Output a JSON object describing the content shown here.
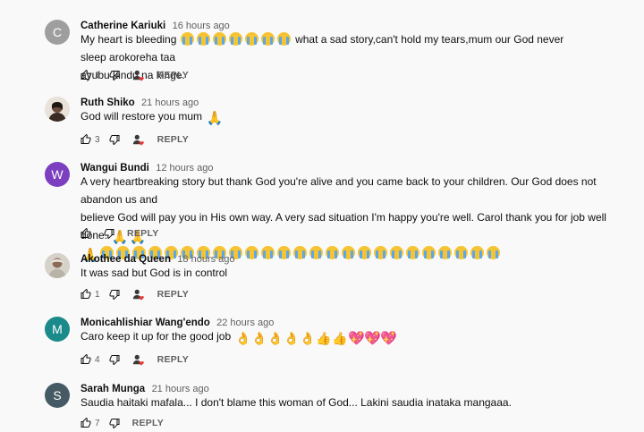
{
  "comments": [
    {
      "avatar_letter": "C",
      "avatar_color": "#9e9e9e",
      "author": "Catherine Kariuki",
      "time": "16 hours ago",
      "text_a": "My heart is bleeding",
      "text_b": "what a sad story,can't hold my tears,mum our God never sleep arokoreha taa",
      "text_c": "ayubu kindu na kinge.",
      "likes": "1",
      "reply_label": "REPLY"
    },
    {
      "avatar_letter": "",
      "author": "Ruth Shiko",
      "time": "21 hours ago",
      "text_a": "God will restore you mum",
      "likes": "3",
      "reply_label": "REPLY"
    },
    {
      "avatar_letter": "W",
      "avatar_color": "#7b3fbf",
      "author": "Wangui Bundi",
      "time": "12 hours ago",
      "text_a": "A very heartbreaking story but thank God you're alive and you came back to your children. Our God does not abandon us and",
      "text_b": "believe God will pay you in His own way. A very sad situation I'm happy you're well. Carol thank you for job well done.",
      "likes": "",
      "reply_label": "REPLY"
    },
    {
      "avatar_letter": "",
      "author": "Akothee da Queen",
      "time": "18 hours ago",
      "text_a": "It was sad but God is in control",
      "likes": "1",
      "reply_label": "REPLY"
    },
    {
      "avatar_letter": "M",
      "avatar_color": "#1b8a8a",
      "author": "Monicahlishiar Wang'endo",
      "time": "22 hours ago",
      "text_a": "Caro keep it up for the good job",
      "likes": "4",
      "reply_label": "REPLY"
    },
    {
      "avatar_letter": "S",
      "avatar_color": "#455a64",
      "author": "Sarah Munga",
      "time": "21 hours ago",
      "text_a": "Saudia haitaki mafala... I don't blame this woman of God... Lakini saudia inataka mangaaa.",
      "likes": "7",
      "reply_label": "REPLY"
    }
  ],
  "icons": {
    "like": "thumb-up-icon",
    "dislike": "thumb-down-icon",
    "creator_heart": "creator-heart-icon",
    "cry": "loudly-crying-face-emoji",
    "pray": "folded-hands-emoji",
    "ok": "ok-hand-emoji",
    "thumbs": "thumbs-up-emoji",
    "heart": "sparkling-heart-emoji"
  }
}
